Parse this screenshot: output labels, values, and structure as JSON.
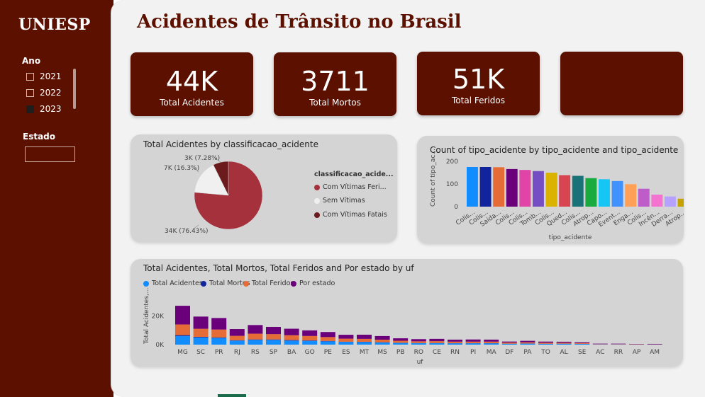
{
  "brand": "UNIESP",
  "page_title": "Acidentes de Trânsito no Brasil",
  "slicers": {
    "ano": {
      "title": "Ano",
      "items": [
        {
          "label": "2021",
          "checked": false
        },
        {
          "label": "2022",
          "checked": false
        },
        {
          "label": "2023",
          "checked": true
        }
      ]
    },
    "estado": {
      "title": "Estado",
      "value": ""
    }
  },
  "kpis": [
    {
      "value": "44K",
      "label": "Total Acidentes"
    },
    {
      "value": "3711",
      "label": "Total Mortos"
    },
    {
      "value": "51K",
      "label": "Total Feridos"
    },
    {
      "value": "",
      "label": ""
    }
  ],
  "colors": {
    "brand": "#5b1000",
    "pie_main": "#a4313c",
    "pie_light": "#f0f0f0",
    "pie_dark": "#6b1b1b",
    "total_acidentes": "#118dff",
    "total_mortos": "#12239e",
    "total_feridos": "#e66c37",
    "por_estado": "#6b007b"
  },
  "pie_chart": {
    "title": "Total Acidentes by classificacao_acidente",
    "legend_title": "classificacao_acide...",
    "legend": [
      "Com Vítimas Feri...",
      "Sem Vítimas",
      "Com Vítimas Fatais"
    ],
    "chart_data": {
      "type": "pie",
      "title": "Total Acidentes by classificacao_acidente",
      "slices": [
        {
          "name": "Com Vítimas Feridas",
          "value": 76.43,
          "label": "34K (76.43%)"
        },
        {
          "name": "Sem Vítimas",
          "value": 16.3,
          "label": "7K (16.3%)"
        },
        {
          "name": "Com Vítimas Fatais",
          "value": 7.28,
          "label": "3K (7.28%)"
        }
      ]
    }
  },
  "bar_chart_tipo": {
    "title": "Count of tipo_acidente by tipo_acidente and tipo_acidente",
    "ylabel": "Count of tipo_ac...",
    "xlabel": "tipo_acidente",
    "yticks": [
      "200",
      "100",
      "0"
    ],
    "chart_data": {
      "type": "bar",
      "categories": [
        "Colis...",
        "Colis...",
        "Saída...",
        "Colis...",
        "Colis...",
        "Tomb...",
        "Colis...",
        "Qued...",
        "Colis...",
        "Atrop...",
        "Capo...",
        "Event...",
        "Enga...",
        "Colis...",
        "Incên...",
        "Derra...",
        "Atrop..."
      ],
      "values": [
        175,
        175,
        174,
        166,
        162,
        157,
        150,
        139,
        136,
        126,
        121,
        113,
        99,
        79,
        53,
        45,
        35
      ],
      "colors": [
        "#118dff",
        "#12239e",
        "#e66c37",
        "#6b007b",
        "#e044a7",
        "#744ec2",
        "#d9b300",
        "#d64550",
        "#197278",
        "#1aab40",
        "#15c6f4",
        "#4092ff",
        "#ffa058",
        "#be5dc9",
        "#f472d0",
        "#b5a1ff",
        "#c4a200"
      ],
      "xlabel": "tipo_acidente",
      "ylabel": "Count of tipo_ac...",
      "ylim": [
        0,
        200
      ]
    }
  },
  "bar_chart_uf": {
    "title": "Total Acidentes, Total Mortos, Total Feridos and Por estado by uf",
    "legend": [
      "Total Acidentes",
      "Total Mortos",
      "Total Feridos",
      "Por estado"
    ],
    "ylabel": "Total Acidentes,...",
    "xlabel": "uf",
    "yticks": [
      "20K",
      "0K"
    ],
    "chart_data": {
      "type": "bar",
      "categories": [
        "MG",
        "SC",
        "PR",
        "RJ",
        "RS",
        "SP",
        "BA",
        "GO",
        "PE",
        "ES",
        "MT",
        "MS",
        "PB",
        "RO",
        "CE",
        "RN",
        "PI",
        "MA",
        "DF",
        "PA",
        "TO",
        "AL",
        "SE",
        "AC",
        "RR",
        "AP",
        "AM"
      ],
      "series": [
        {
          "name": "Total Acidentes",
          "values": [
            6000,
            5000,
            4600,
            2800,
            3300,
            3300,
            2800,
            2600,
            2300,
            1900,
            1800,
            1500,
            1200,
            1000,
            1000,
            900,
            900,
            900,
            600,
            700,
            550,
            600,
            500,
            150,
            150,
            100,
            100
          ]
        },
        {
          "name": "Total Mortos",
          "values": [
            600,
            400,
            400,
            200,
            300,
            300,
            350,
            300,
            250,
            150,
            200,
            150,
            100,
            100,
            100,
            80,
            80,
            90,
            40,
            80,
            60,
            60,
            50,
            20,
            15,
            10,
            10
          ]
        },
        {
          "name": "Total Feridos",
          "values": [
            7400,
            5600,
            5500,
            3100,
            4000,
            3700,
            3400,
            3100,
            2700,
            2100,
            2000,
            1800,
            1400,
            1200,
            1300,
            1100,
            1100,
            1100,
            800,
            850,
            700,
            650,
            550,
            200,
            200,
            150,
            100
          ]
        },
        {
          "name": "Por estado",
          "values": [
            13000,
            8500,
            8000,
            4700,
            6000,
            5000,
            4500,
            3900,
            3500,
            2700,
            2900,
            2500,
            1700,
            1500,
            1600,
            1400,
            1500,
            1400,
            700,
            1000,
            800,
            700,
            600,
            300,
            300,
            200,
            300
          ]
        }
      ],
      "xlabel": "uf",
      "ylabel": "Total Acidentes,...",
      "ylim": [
        0,
        30000
      ]
    }
  }
}
